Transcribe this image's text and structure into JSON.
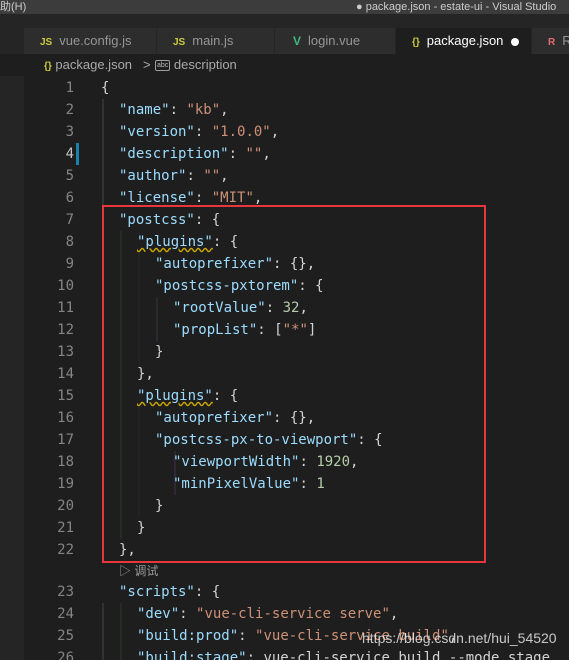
{
  "titlebar": {
    "menu": "助(H)",
    "window_title": "● package.json - estate-ui - Visual Studio"
  },
  "tabs": [
    {
      "icon": "JS",
      "label": "vue.config.js"
    },
    {
      "icon": "JS",
      "label": "main.js"
    },
    {
      "icon": "V",
      "label": "login.vue"
    },
    {
      "icon": "{}",
      "label": "package.json"
    },
    {
      "icon": "R",
      "label": "R"
    }
  ],
  "breadcrumb": {
    "file": "package.json",
    "separator": ">",
    "symbol_icon": "abc",
    "symbol": "description"
  },
  "codelens": "▷ 调试",
  "code_lines": [
    {
      "n": "1",
      "text": "{"
    },
    {
      "n": "2",
      "text": "\"name\": \"kb\","
    },
    {
      "n": "3",
      "text": "\"version\": \"1.0.0\","
    },
    {
      "n": "4",
      "text": "\"description\": \"\","
    },
    {
      "n": "5",
      "text": "\"author\": \"\","
    },
    {
      "n": "6",
      "text": "\"license\": \"MIT\","
    },
    {
      "n": "7",
      "text": "\"postcss\": {"
    },
    {
      "n": "8",
      "text": "\"plugins\": {"
    },
    {
      "n": "9",
      "text": "\"autoprefixer\": {},"
    },
    {
      "n": "10",
      "text": "\"postcss-pxtorem\": {"
    },
    {
      "n": "11",
      "text": "\"rootValue\": 32,"
    },
    {
      "n": "12",
      "text": "\"propList\": [\"*\"]"
    },
    {
      "n": "13",
      "text": "}"
    },
    {
      "n": "14",
      "text": "},"
    },
    {
      "n": "15",
      "text": "\"plugins\": {"
    },
    {
      "n": "16",
      "text": "\"autoprefixer\": {},"
    },
    {
      "n": "17",
      "text": "\"postcss-px-to-viewport\": {"
    },
    {
      "n": "18",
      "text": "\"viewportWidth\": 1920,"
    },
    {
      "n": "19",
      "text": "\"minPixelValue\": 1"
    },
    {
      "n": "20",
      "text": "}"
    },
    {
      "n": "21",
      "text": "}"
    },
    {
      "n": "22",
      "text": "},"
    },
    {
      "n": "23",
      "text": "\"scripts\": {"
    },
    {
      "n": "24",
      "text": "\"dev\": \"vue-cli-service serve\","
    },
    {
      "n": "25",
      "text": "\"build:prod\": \"vue-cli-service build\","
    },
    {
      "n": "26",
      "text": "\"build:stage\": \"vue-cli-service build --mode stage"
    }
  ],
  "current_line": "4",
  "watermark": "https://blog.csdn.net/hui_54520",
  "colors": {
    "highlight_border": "#e8363d",
    "modified_gutter": "#1b81a8"
  }
}
